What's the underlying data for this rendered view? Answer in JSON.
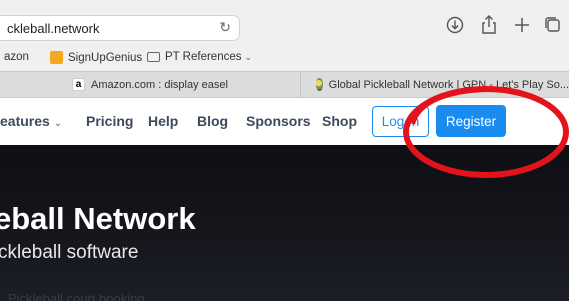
{
  "browser": {
    "url": "ckleball.network",
    "bookmarks": [
      {
        "label": "azon"
      },
      {
        "label": "SignUpGenius"
      },
      {
        "label": "PT References"
      }
    ],
    "tabs": [
      {
        "label": "Amazon.com : display easel"
      },
      {
        "label": "Global Pickleball Network | GPN - Let's Play So..."
      }
    ]
  },
  "site_nav": {
    "items": [
      {
        "label": "eatures"
      },
      {
        "label": "Pricing"
      },
      {
        "label": "Help"
      },
      {
        "label": "Blog"
      },
      {
        "label": "Sponsors"
      },
      {
        "label": "Shop"
      }
    ],
    "login_label": "Log In",
    "register_label": "Register"
  },
  "hero": {
    "title": "eball Network",
    "subtitle": "ckleball software",
    "faint_text": "Pickleball court booking"
  },
  "colors": {
    "accent": "#1a8cf0",
    "annotation": "#e3131b",
    "hero_bg": "#111217"
  }
}
